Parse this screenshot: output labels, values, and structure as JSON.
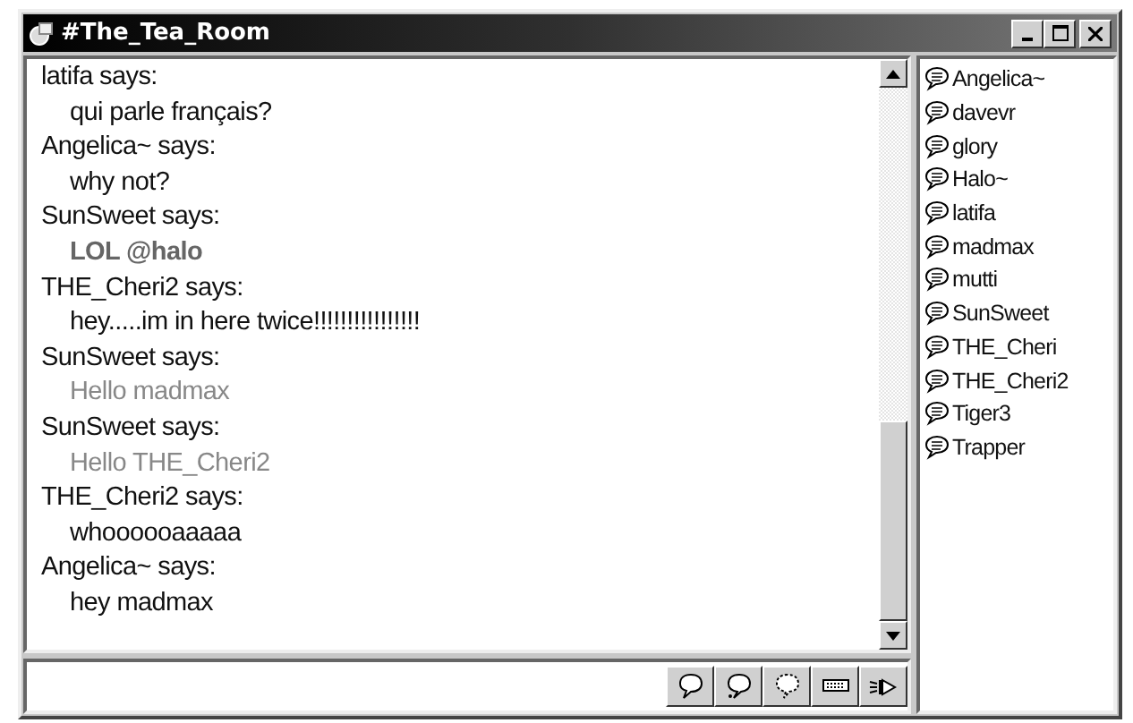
{
  "window": {
    "title": "#The_Tea_Room"
  },
  "messages": [
    {
      "sender": "latifa says:",
      "text": "qui parle français?",
      "kind": "normal"
    },
    {
      "sender": "Angelica~ says:",
      "text": "why not?",
      "kind": "normal"
    },
    {
      "sender": "SunSweet says:",
      "text": "LOL @halo",
      "kind": "bold"
    },
    {
      "sender": "THE_Cheri2 says:",
      "text": "hey.....im in here twice!!!!!!!!!!!!!!!!",
      "kind": "normal"
    },
    {
      "sender": "SunSweet says:",
      "text": "Hello  madmax",
      "kind": "faint"
    },
    {
      "sender": "SunSweet says:",
      "text": "Hello  THE_Cheri2",
      "kind": "faint"
    },
    {
      "sender": "THE_Cheri2 says:",
      "text": "whoooooaaaaa",
      "kind": "normal"
    },
    {
      "sender": "Angelica~ says:",
      "text": "hey madmax",
      "kind": "normal"
    }
  ],
  "users": [
    "Angelica~",
    "davevr",
    "glory",
    "Halo~",
    "latifa",
    "madmax",
    "mutti",
    "SunSweet",
    "THE_Cheri",
    "THE_Cheri2",
    "Tiger3",
    "Trapper"
  ],
  "toolbar": [
    {
      "kind": "say"
    },
    {
      "kind": "think"
    },
    {
      "kind": "whisper"
    },
    {
      "kind": "keyboard"
    },
    {
      "kind": "sound"
    }
  ]
}
